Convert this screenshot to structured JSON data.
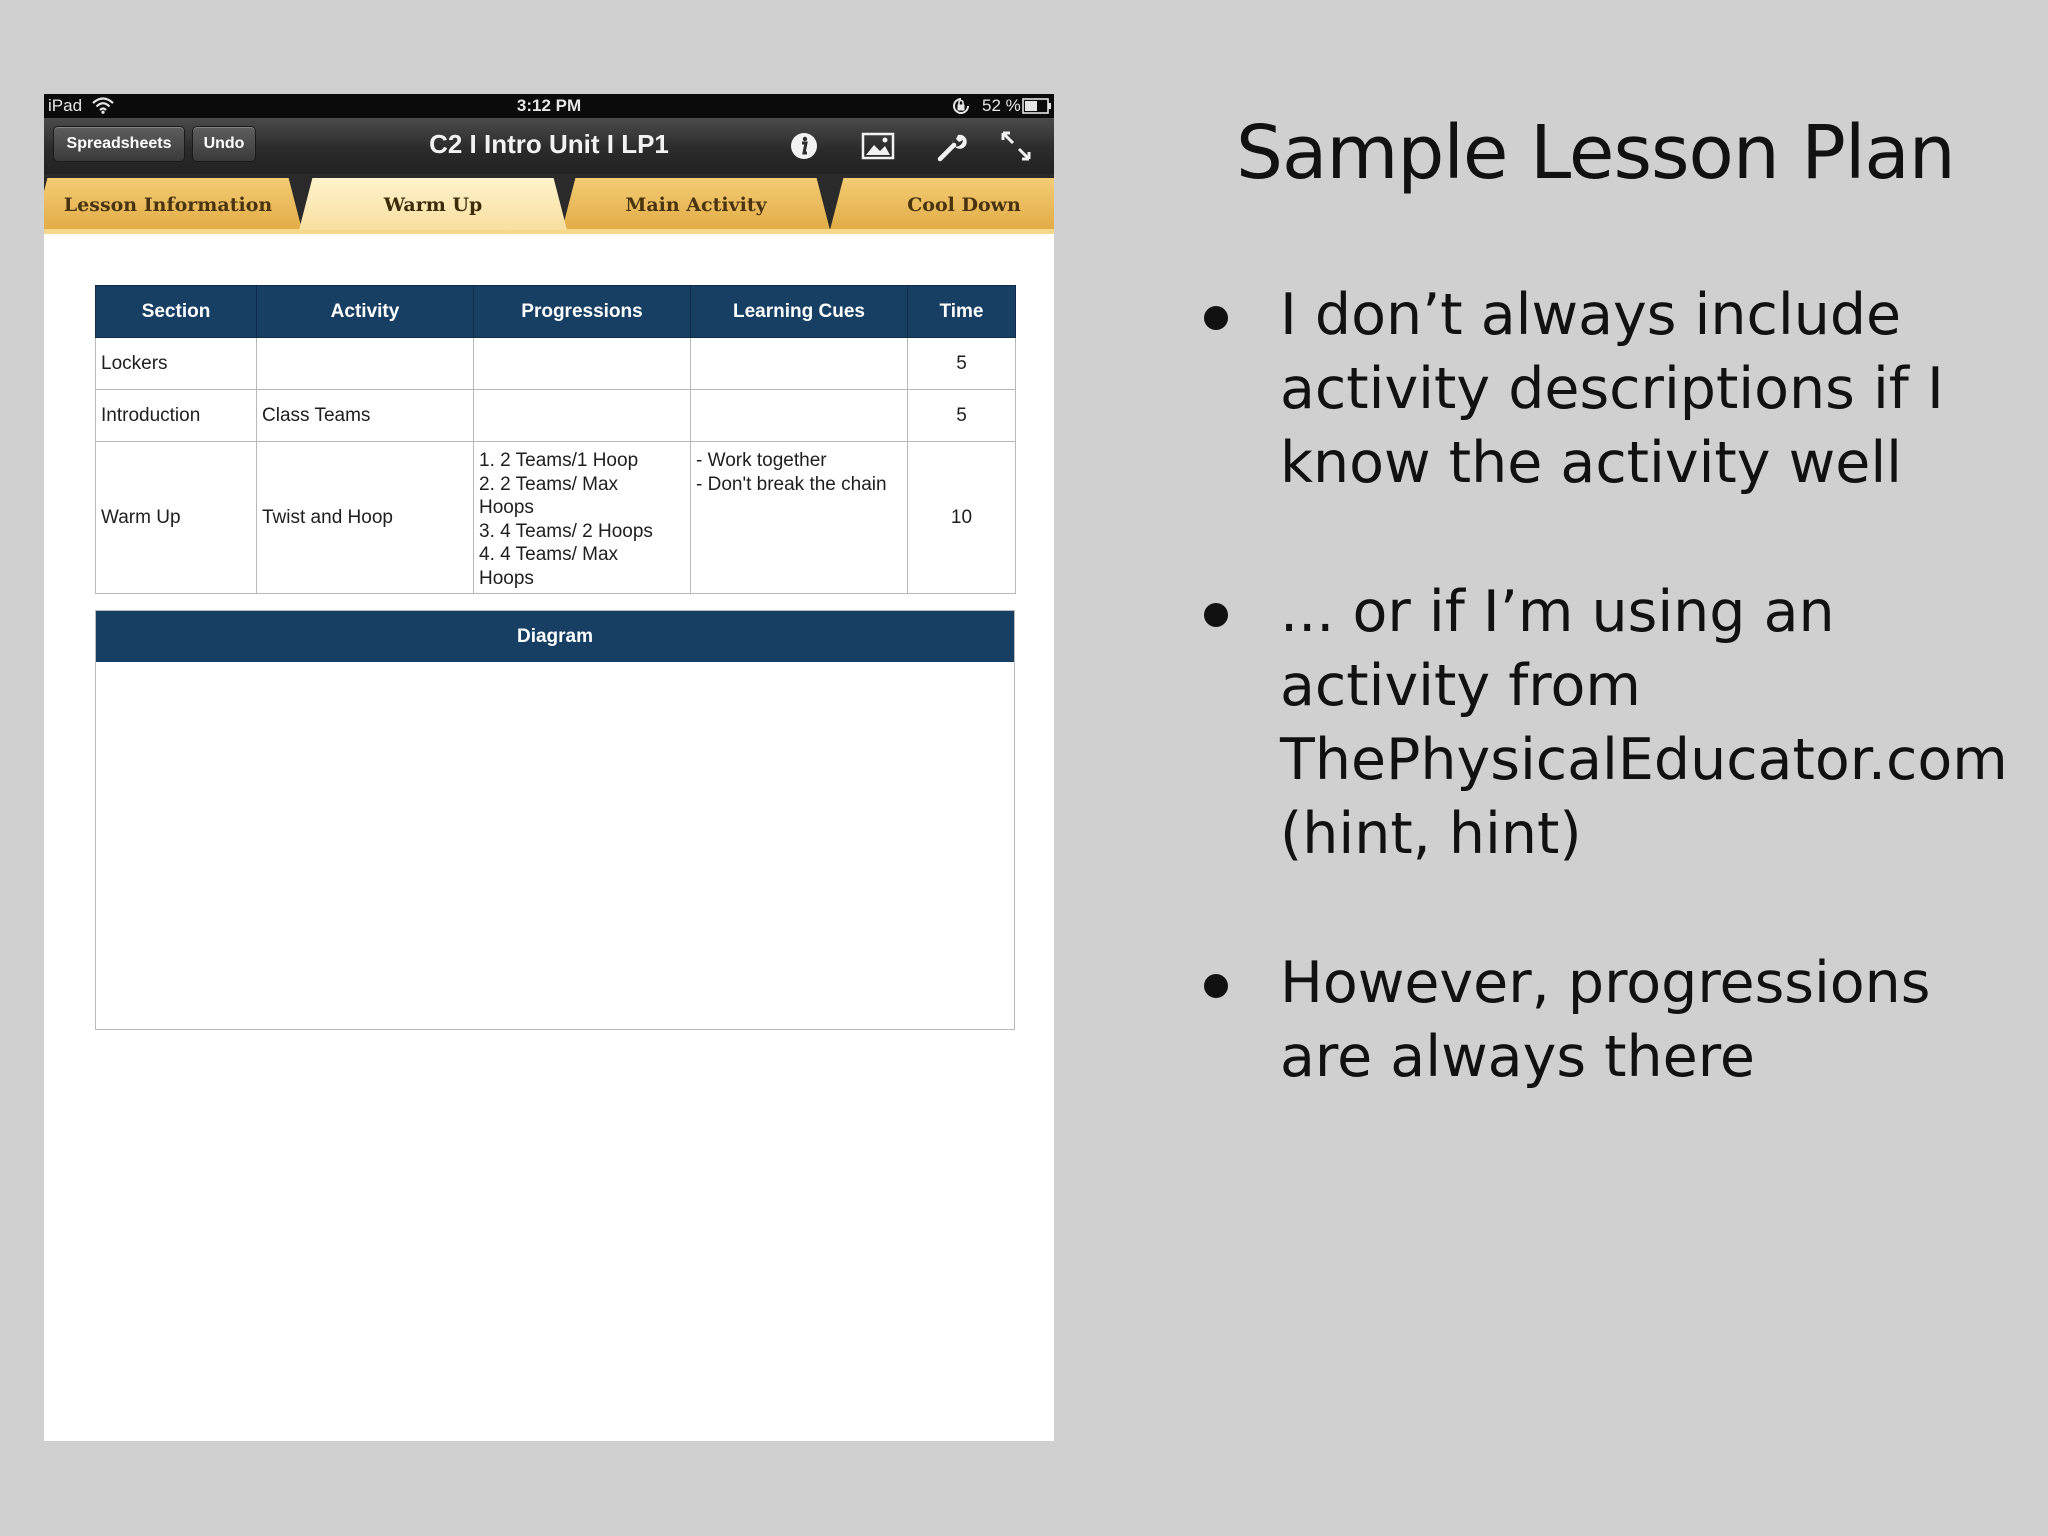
{
  "status_bar": {
    "device": "iPad",
    "time": "3:12 PM",
    "battery": "52 %"
  },
  "toolbar": {
    "spreadsheets_label": "Spreadsheets",
    "undo_label": "Undo",
    "title": "C2 I Intro Unit I LP1"
  },
  "tabs": [
    {
      "label": "Lesson Information",
      "active": false
    },
    {
      "label": "Warm Up",
      "active": true
    },
    {
      "label": "Main Activity",
      "active": false
    },
    {
      "label": "Cool Down",
      "active": false
    }
  ],
  "lesson_table": {
    "headers": [
      "Section",
      "Activity",
      "Progressions",
      "Learning Cues",
      "Time"
    ],
    "rows": [
      {
        "section": "Lockers",
        "activity": "",
        "progressions": [],
        "learning_cues": [],
        "time": "5"
      },
      {
        "section": "Introduction",
        "activity": "Class Teams",
        "progressions": [],
        "learning_cues": [],
        "time": "5"
      },
      {
        "section": "Warm Up",
        "activity": "Twist and Hoop",
        "progressions": [
          "1. 2 Teams/1 Hoop",
          "2. 2 Teams/ Max",
          "Hoops",
          "3. 4 Teams/ 2 Hoops",
          "4. 4 Teams/ Max",
          "Hoops"
        ],
        "learning_cues": [
          "- Work together",
          "- Don't break the chain"
        ],
        "time": "10"
      }
    ]
  },
  "diagram": {
    "header": "Diagram"
  },
  "slide": {
    "title": "Sample Lesson Plan",
    "bullets": [
      "I don’t always include activity descriptions if I know the activity well",
      "... or if I’m using an activity from ThePhysicalEducator.com (hint, hint)",
      "However, progressions are always there"
    ]
  },
  "icons": [
    "wifi-icon",
    "rotation-lock-icon",
    "battery-icon",
    "info-icon",
    "image-icon",
    "wrench-icon",
    "expand-icon"
  ],
  "colors": {
    "table_header": "#173f63",
    "tab_gold": "#e2ac47",
    "tab_active": "#fff3cc",
    "slide_background": "#d0d0d0"
  }
}
